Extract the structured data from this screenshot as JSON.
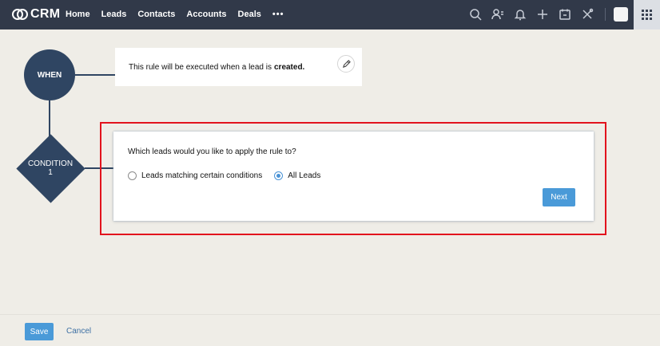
{
  "app": {
    "logo_text": "CRM"
  },
  "nav": {
    "items": [
      "Home",
      "Leads",
      "Contacts",
      "Accounts",
      "Deals"
    ],
    "more": "•••"
  },
  "toolbar_icons": [
    "search-icon",
    "contacts-icon",
    "bell-icon",
    "plus-icon",
    "calendar-icon",
    "tools-icon",
    "avatar",
    "apps-grid-icon"
  ],
  "flow": {
    "when_label": "WHEN",
    "condition_label": "CONDITION",
    "condition_number": "1",
    "when_text": "This rule will be executed when a lead is",
    "when_text_bold": "created."
  },
  "condition_card": {
    "question": "Which leads would you like to apply the rule to?",
    "options": [
      {
        "label": "Leads matching certain conditions",
        "selected": false
      },
      {
        "label": "All Leads",
        "selected": true
      }
    ],
    "next_label": "Next"
  },
  "footer": {
    "save_label": "Save",
    "cancel_label": "Cancel"
  },
  "colors": {
    "nav_bg": "#313949",
    "node": "#2f4562",
    "primary": "#4a9ad8",
    "highlight": "#e2131d"
  }
}
